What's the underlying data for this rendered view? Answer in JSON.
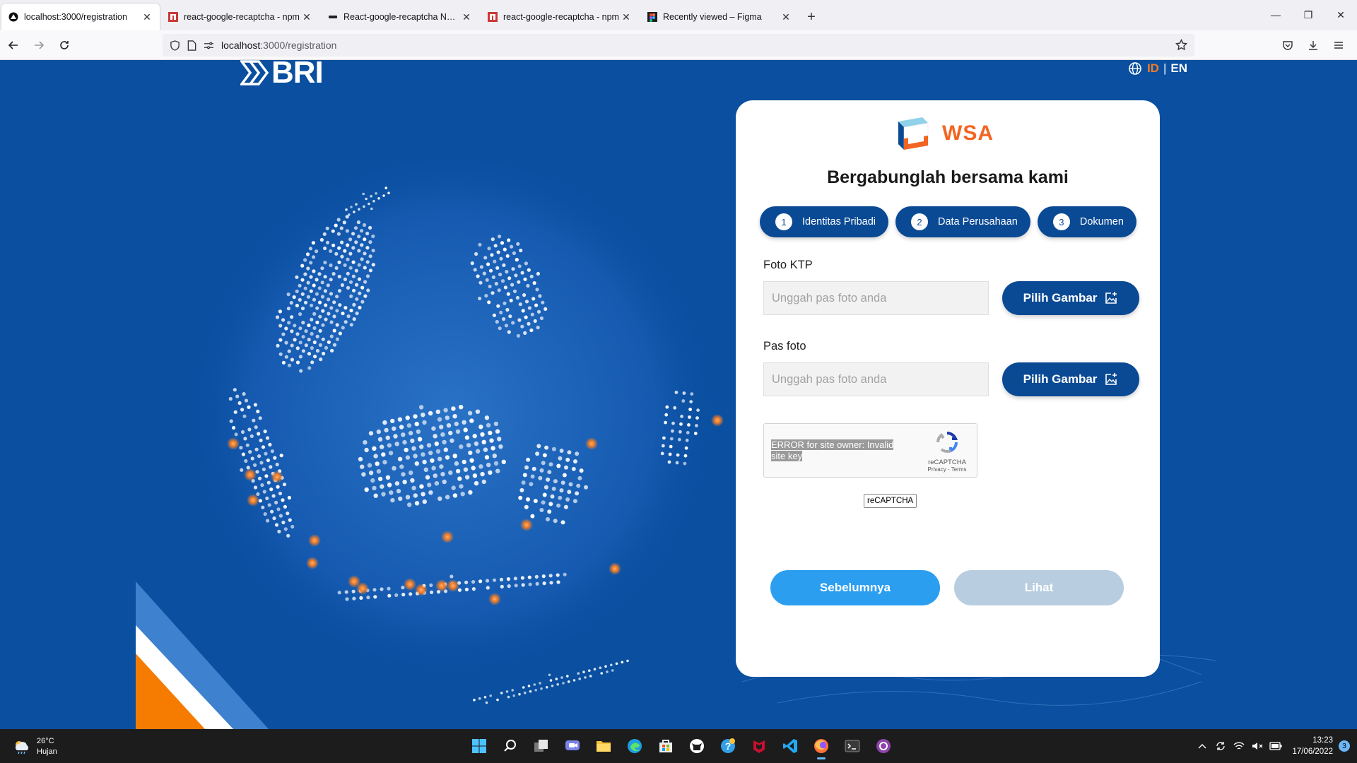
{
  "browser": {
    "tabs": [
      {
        "title": "localhost:3000/registration",
        "active": true,
        "icon": "localhost-icon"
      },
      {
        "title": "react-google-recaptcha - npm",
        "active": false,
        "icon": "npm-icon"
      },
      {
        "title": "React-google-recaptcha NPM | ",
        "active": false,
        "icon": "site-icon"
      },
      {
        "title": "react-google-recaptcha - npm",
        "active": false,
        "icon": "npm-icon"
      },
      {
        "title": "Recently viewed – Figma",
        "active": false,
        "icon": "figma-icon"
      }
    ],
    "url_host": "localhost",
    "url_path": ":3000/registration"
  },
  "page": {
    "brand": "BRI",
    "lang_id": "ID",
    "lang_sep": "|",
    "lang_en": "EN",
    "accent_color": "#f27d26",
    "primary_color": "#0a4a94"
  },
  "card": {
    "app_name": "WSA",
    "title": "Bergabunglah bersama kami",
    "steps": [
      {
        "num": "1",
        "label": "Identitas Pribadi"
      },
      {
        "num": "2",
        "label": "Data Perusahaan"
      },
      {
        "num": "3",
        "label": "Dokumen"
      }
    ],
    "ktp_label": "Foto KTP",
    "ktp_placeholder": "Unggah pas foto anda",
    "photo_label": "Pas foto",
    "photo_placeholder": "Unggah pas foto anda",
    "pick_image": "Pilih Gambar",
    "recaptcha_error": "ERROR for site owner: Invalid site key",
    "recaptcha_name": "reCAPTCHA",
    "recaptcha_terms": "Privacy - Terms",
    "recaptcha_badge": "reCAPTCHA",
    "prev_button": "Sebelumnya",
    "next_button": "Lihat"
  },
  "taskbar": {
    "weather_temp": "26°C",
    "weather_desc": "Hujan",
    "time": "13:23",
    "date": "17/06/2022",
    "notifications": "3"
  }
}
